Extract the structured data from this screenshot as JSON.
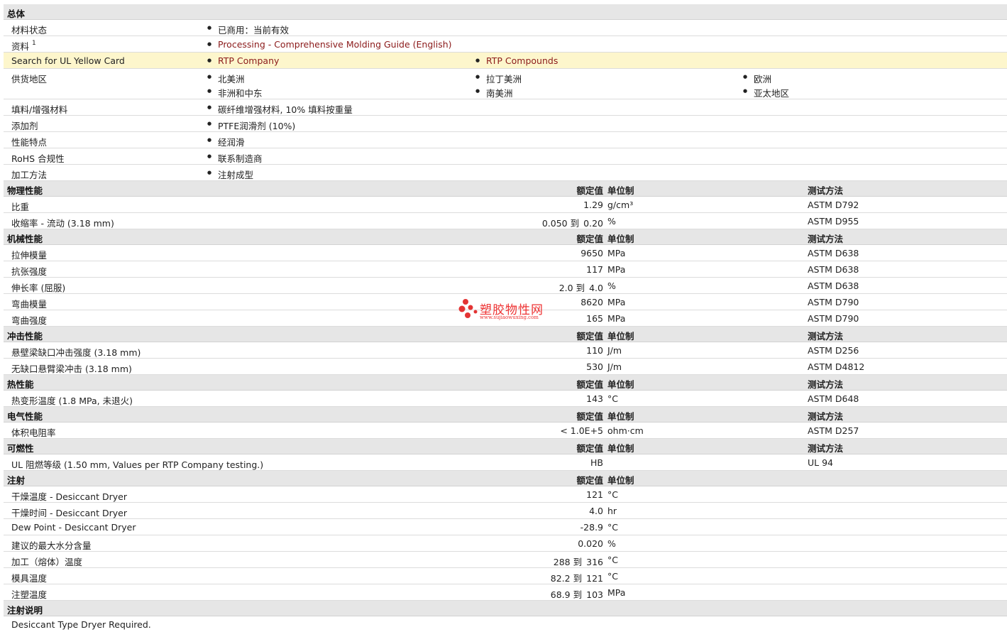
{
  "general": {
    "title": "总体",
    "rows": [
      {
        "label": "材料状态",
        "items": [
          "已商用：当前有效"
        ]
      },
      {
        "label": "资料",
        "sup": "1",
        "items": [
          "Processing - Comprehensive Molding Guide (English)"
        ],
        "link": true
      },
      {
        "label": "Search for UL Yellow Card",
        "items": [
          "RTP Company",
          "RTP Compounds"
        ],
        "link": true,
        "highlight": true
      },
      {
        "label": "供货地区",
        "items": [
          "北美洲",
          "拉丁美洲",
          "欧洲",
          "非洲和中东",
          "南美洲",
          "亚太地区"
        ]
      },
      {
        "label": "填料/增强材料",
        "items": [
          "碳纤维增强材料, 10% 填料按重量"
        ]
      },
      {
        "label": "添加剂",
        "items": [
          "PTFE润滑剂 (10%)"
        ]
      },
      {
        "label": "性能特点",
        "items": [
          "经润滑"
        ]
      },
      {
        "label": "RoHS 合规性",
        "items": [
          "联系制造商"
        ]
      },
      {
        "label": "加工方法",
        "items": [
          "注射成型"
        ]
      }
    ]
  },
  "headers": {
    "value": "额定值",
    "unit": "单位制",
    "method": "测试方法"
  },
  "sections": [
    {
      "title": "物理性能",
      "show_method": true,
      "rows": [
        {
          "label": "比重",
          "value": "1.29",
          "unit": "g/cm³",
          "method": "ASTM D792"
        },
        {
          "label": "收缩率  - 流动  (3.18 mm)",
          "value": "0.050",
          "to": "到",
          "value2": "0.20",
          "unit": "%",
          "method": "ASTM D955"
        }
      ]
    },
    {
      "title": "机械性能",
      "show_method": true,
      "rows": [
        {
          "label": "拉伸模量",
          "value": "9650",
          "unit": "MPa",
          "method": "ASTM D638"
        },
        {
          "label": "抗张强度",
          "value": "117",
          "unit": "MPa",
          "method": "ASTM D638"
        },
        {
          "label": "伸长率  (屈服)",
          "value": "2.0",
          "to": "到",
          "value2": "4.0",
          "unit": "%",
          "method": "ASTM D638"
        },
        {
          "label": "弯曲模量",
          "value": "8620",
          "unit": "MPa",
          "method": "ASTM D790"
        },
        {
          "label": "弯曲强度",
          "value": "165",
          "unit": "MPa",
          "method": "ASTM D790"
        }
      ]
    },
    {
      "title": "冲击性能",
      "show_method": true,
      "rows": [
        {
          "label": "悬壁梁缺口冲击强度  (3.18 mm)",
          "value": "110",
          "unit": "J/m",
          "method": "ASTM D256"
        },
        {
          "label": "无缺口悬臂梁冲击  (3.18 mm)",
          "value": "530",
          "unit": "J/m",
          "method": "ASTM D4812"
        }
      ]
    },
    {
      "title": "热性能",
      "show_method": true,
      "rows": [
        {
          "label": "热变形温度  (1.8 MPa, 未退火)",
          "value": "143",
          "unit": "°C",
          "method": "ASTM D648"
        }
      ]
    },
    {
      "title": "电气性能",
      "show_method": true,
      "rows": [
        {
          "label": "体积电阻率",
          "value": "< 1.0E+5",
          "unit": "ohm·cm",
          "method": "ASTM D257"
        }
      ]
    },
    {
      "title": "可燃性",
      "show_method": true,
      "rows": [
        {
          "label": "UL 阻燃等级  (1.50 mm, Values per RTP Company testing.)",
          "value": "HB",
          "unit": "",
          "method": "UL 94"
        }
      ]
    },
    {
      "title": "注射",
      "show_method": false,
      "rows": [
        {
          "label": "干燥温度  - Desiccant Dryer",
          "value": "121",
          "unit": "°C"
        },
        {
          "label": "干燥时间  - Desiccant Dryer",
          "value": "4.0",
          "unit": "hr"
        },
        {
          "label": "Dew Point - Desiccant Dryer",
          "value": "-28.9",
          "unit": "°C"
        },
        {
          "label": "建议的最大水分含量",
          "value": "0.020",
          "unit": "%"
        },
        {
          "label": "加工（熔体）温度",
          "value": "288",
          "to": "到",
          "value2": "316",
          "unit": "°C"
        },
        {
          "label": "模具温度",
          "value": "82.2",
          "to": "到",
          "value2": "121",
          "unit": "°C"
        },
        {
          "label": "注塑温度",
          "value": "68.9",
          "to": "到",
          "value2": "103",
          "unit": "MPa"
        }
      ]
    }
  ],
  "notes": {
    "title": "注射说明",
    "text": "Desiccant Type Dryer Required."
  },
  "watermark": {
    "name": "塑胶物性网",
    "url": "www.sujiaowuxing.com",
    "color": "#e33333"
  }
}
